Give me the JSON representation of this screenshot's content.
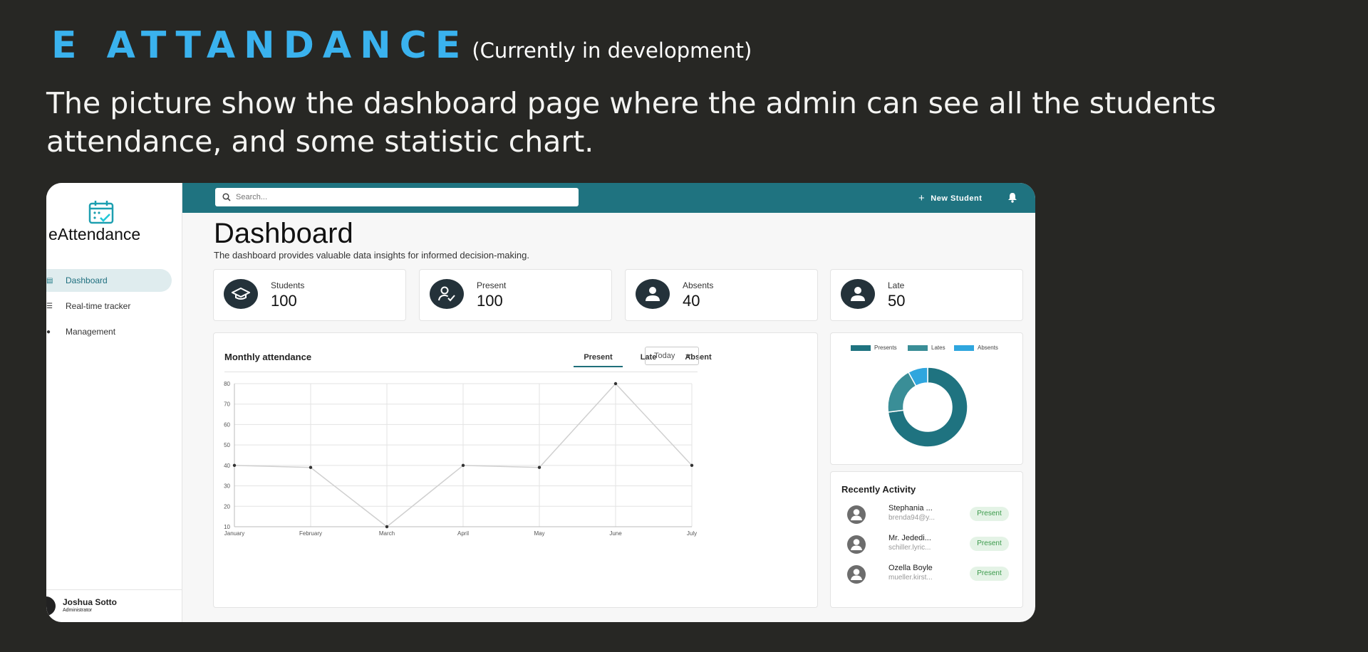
{
  "slide": {
    "title": "E ATTANDANCE",
    "title_note": "(Currently in development)",
    "description": "The picture show the dashboard page where the admin can see all the students attendance, and some statistic chart."
  },
  "app": {
    "name": "eAttendance",
    "accent_color": "#1f7380",
    "nav": [
      {
        "label": "Dashboard",
        "icon": "dashboard-icon",
        "active": true
      },
      {
        "label": "Real-time tracker",
        "icon": "tracker-icon",
        "active": false
      },
      {
        "label": "Management",
        "icon": "people-icon",
        "active": false
      }
    ],
    "user": {
      "name": "Joshua Sotto",
      "role": "Administrator"
    }
  },
  "topbar": {
    "search_placeholder": "Search...",
    "new_student_label": "New Student"
  },
  "dashboard": {
    "title": "Dashboard",
    "subtitle": "The dashboard provides valuable data insights for informed decision-making.",
    "stats": [
      {
        "label": "Students",
        "value": "100",
        "icon": "graduation-cap-icon"
      },
      {
        "label": "Present",
        "value": "100",
        "icon": "user-check-icon"
      },
      {
        "label": "Absents",
        "value": "40",
        "icon": "person-icon"
      },
      {
        "label": "Late",
        "value": "50",
        "icon": "person-icon"
      }
    ]
  },
  "monthly": {
    "title": "Monthly attendance",
    "tabs": [
      "Present",
      "Late",
      "Absent"
    ],
    "active_tab": "Present",
    "range": "Today"
  },
  "chart_data": [
    {
      "type": "line",
      "title": "Monthly attendance",
      "categories": [
        "January",
        "February",
        "March",
        "April",
        "May",
        "June",
        "July"
      ],
      "series": [
        {
          "values": [
            40,
            39,
            10,
            40,
            39,
            80,
            40
          ]
        }
      ],
      "ylim": [
        10,
        80
      ],
      "yticks": [
        10,
        20,
        30,
        40,
        50,
        60,
        70,
        80
      ],
      "grid": true,
      "line_color": "#d0d0d0"
    },
    {
      "type": "pie",
      "donut": true,
      "legend_position": "top",
      "series": [
        {
          "name": "Presents",
          "value": 73,
          "color": "#1f7380"
        },
        {
          "name": "Lates",
          "value": 19,
          "color": "#3a8e97"
        },
        {
          "name": "Absents",
          "value": 8,
          "color": "#2fa6de"
        }
      ]
    }
  ],
  "activity": {
    "title": "Recently Activity",
    "items": [
      {
        "name": "Stephania ...",
        "email": "brenda94@y...",
        "status": "Present"
      },
      {
        "name": "Mr. Jededi...",
        "email": "schiller.lyric...",
        "status": "Present"
      },
      {
        "name": "Ozella Boyle",
        "email": "mueller.kirst...",
        "status": "Present"
      }
    ]
  }
}
